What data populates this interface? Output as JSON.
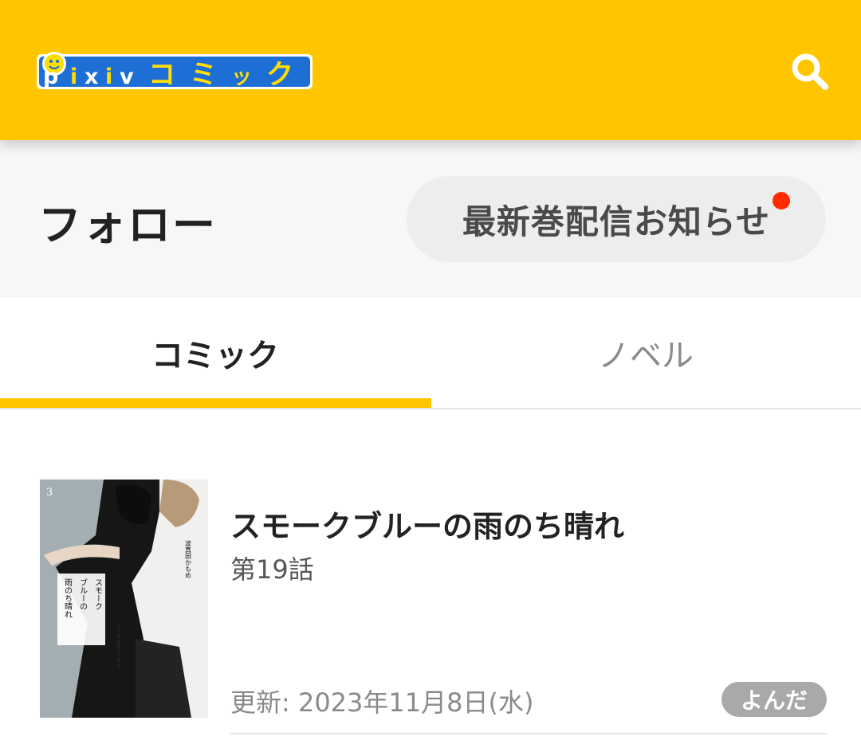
{
  "header": {
    "logo_text": "pixivコミック",
    "logo_letters": [
      "p",
      "i",
      "x",
      "i",
      "v",
      "コ",
      "ミ",
      "ッ",
      "ク"
    ],
    "search_icon": "search-icon",
    "accent_color": "#ffc600"
  },
  "follow": {
    "title": "フォロー",
    "notice_button_label": "最新巻配信お知らせ",
    "notice_dot_color": "#ff2a00"
  },
  "tabs": [
    {
      "label": "コミック",
      "active": true
    },
    {
      "label": "ノベル",
      "active": false
    }
  ],
  "items": [
    {
      "title": "スモークブルーの雨のち晴れ",
      "episode": "第19話",
      "updated": "更新: 2023年11月8日(水)",
      "badge": "よんだ",
      "cover": {
        "volume": "3",
        "title_vertical": [
          "スモーク",
          "ブルーの",
          "雨のち晴れ"
        ],
        "author": "波真田かもめ",
        "subtitle": "LIFE IN SMOKEY BLUE"
      }
    }
  ]
}
